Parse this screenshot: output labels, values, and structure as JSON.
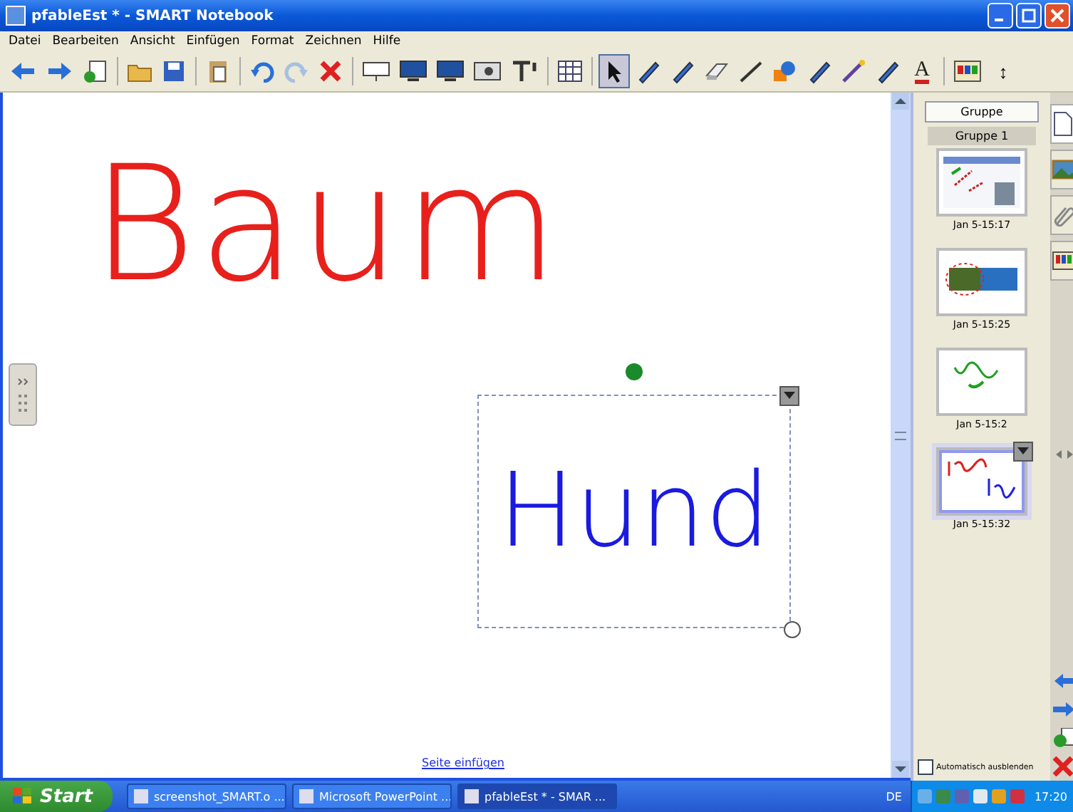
{
  "window": {
    "title": "pfableEst * - SMART Notebook"
  },
  "menu": [
    "Datei",
    "Bearbeiten",
    "Ansicht",
    "Einfügen",
    "Format",
    "Zeichnen",
    "Hilfe"
  ],
  "toolbar": [
    {
      "kind": "back",
      "selected": false
    },
    {
      "kind": "forward",
      "selected": false
    },
    {
      "kind": "newpage",
      "selected": false
    },
    {
      "kind": "sep"
    },
    {
      "kind": "open",
      "selected": false
    },
    {
      "kind": "save",
      "selected": false
    },
    {
      "kind": "sep"
    },
    {
      "kind": "paste",
      "selected": false
    },
    {
      "kind": "sep"
    },
    {
      "kind": "undo",
      "selected": false
    },
    {
      "kind": "redo",
      "selected": false
    },
    {
      "kind": "delete",
      "selected": false
    },
    {
      "kind": "sep"
    },
    {
      "kind": "screen",
      "selected": false
    },
    {
      "kind": "monitor",
      "selected": false
    },
    {
      "kind": "monitor",
      "selected": false
    },
    {
      "kind": "camera",
      "selected": false
    },
    {
      "kind": "textool",
      "selected": false
    },
    {
      "kind": "sep"
    },
    {
      "kind": "table",
      "selected": false
    },
    {
      "kind": "sep"
    },
    {
      "kind": "select",
      "selected": true
    },
    {
      "kind": "pen",
      "selected": false
    },
    {
      "kind": "pen",
      "selected": false
    },
    {
      "kind": "eraser",
      "selected": false
    },
    {
      "kind": "line",
      "selected": false
    },
    {
      "kind": "shape",
      "selected": false
    },
    {
      "kind": "pen",
      "selected": false
    },
    {
      "kind": "wand",
      "selected": false
    },
    {
      "kind": "pen",
      "selected": false
    },
    {
      "kind": "text",
      "label": "A",
      "selected": false
    },
    {
      "kind": "sep"
    },
    {
      "kind": "palette",
      "selected": false
    },
    {
      "kind": "move",
      "label": "↕",
      "selected": false
    }
  ],
  "canvas": {
    "ink": [
      {
        "label": "Baum",
        "color": "#e8201c",
        "selected": false
      },
      {
        "label": "Hund",
        "color": "#1a1ae0",
        "selected": true
      }
    ],
    "add_page_link": "Seite einfügen"
  },
  "sorter": {
    "group_button": "Gruppe",
    "group_label": "Gruppe 1",
    "pages": [
      {
        "kind": "web",
        "label": "Jan 5-15:17",
        "selected": false
      },
      {
        "kind": "photo",
        "label": "Jan 5-15:25",
        "selected": false
      },
      {
        "kind": "green",
        "label": "Jan 5-15:2",
        "selected": false
      },
      {
        "kind": "words",
        "label": "Jan 5-15:32",
        "selected": true
      }
    ],
    "auto_hide": {
      "label": "Automatisch ausblenden",
      "checked": false
    }
  },
  "taskbar": {
    "start": "Start",
    "tasks": [
      {
        "label": "screenshot_SMART.o ...",
        "selected": false
      },
      {
        "label": "Microsoft PowerPoint ...",
        "selected": false
      },
      {
        "label": "pfableEst * - SMAR ...",
        "selected": true
      }
    ],
    "language": "DE",
    "clock": "17:20"
  }
}
